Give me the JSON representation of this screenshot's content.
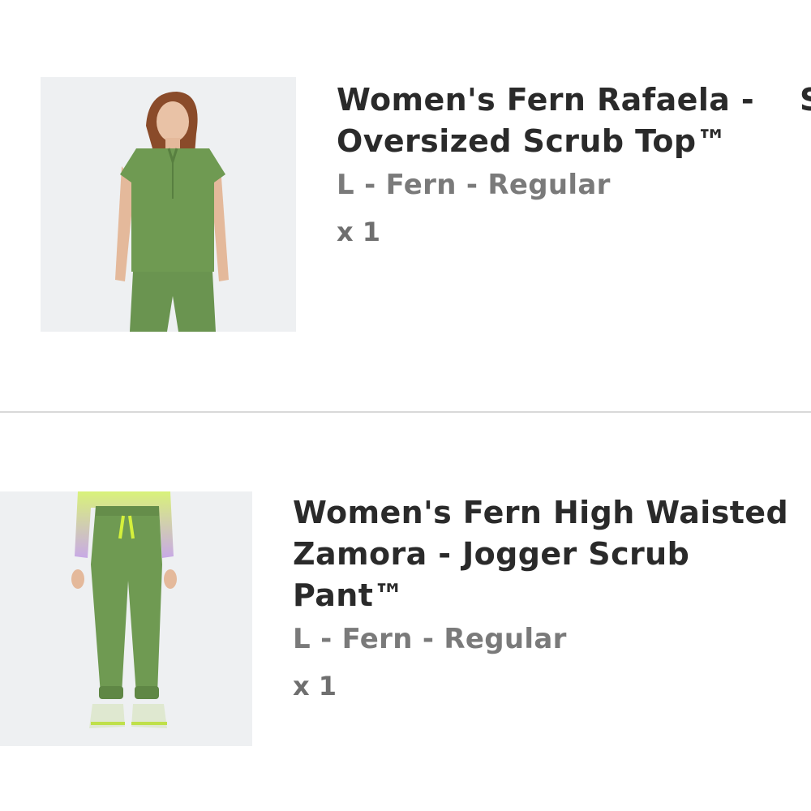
{
  "cart": {
    "items": [
      {
        "title": "Women's Fern Rafaela -\nOversized Scrub Top™",
        "variant": "L - Fern - Regular",
        "quantity": "x 1",
        "price_fragment": "S",
        "image": {
          "alt": "Women's Fern Rafaela Oversized Scrub Top product photo",
          "garment_color": "#6f9a52"
        }
      },
      {
        "title": "Women's Fern High Waisted\nZamora - Jogger Scrub Pant™",
        "variant": "L - Fern - Regular",
        "quantity": "x 1",
        "image": {
          "alt": "Women's Fern High Waisted Zamora Jogger Scrub Pant product photo",
          "garment_color": "#6f9a52"
        }
      }
    ]
  },
  "colors": {
    "title": "#2a2a2a",
    "secondary_text": "#7a7a7a",
    "divider": "#d9d9d9",
    "fern_green": "#6f9a52",
    "accent_lime": "#d4f03c"
  }
}
